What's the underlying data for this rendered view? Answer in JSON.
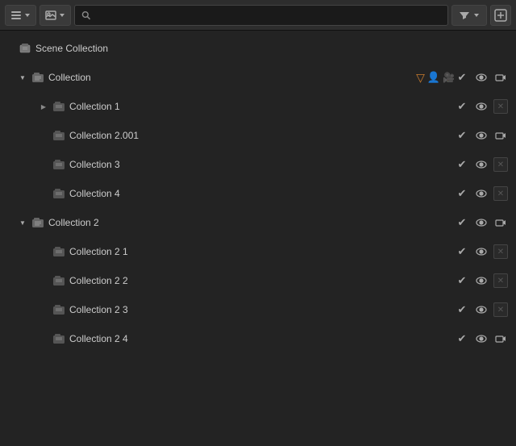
{
  "header": {
    "view_mode_label": "≡",
    "display_mode_label": "🖼",
    "search_placeholder": "",
    "filter_label": "▽",
    "add_label": "+"
  },
  "tree": {
    "items": [
      {
        "id": "scene-collection",
        "label": "Scene Collection",
        "indent": 0,
        "type": "scene",
        "expanded": true,
        "has_arrow": false,
        "show_controls": false,
        "show_cam": false,
        "show_x": false
      },
      {
        "id": "collection",
        "label": "Collection",
        "indent": 1,
        "type": "collection",
        "expanded": true,
        "has_arrow": true,
        "arrow_down": true,
        "show_controls": true,
        "show_cam": true,
        "show_x": false,
        "inline_objects": [
          "cone",
          "lamp",
          "camera"
        ]
      },
      {
        "id": "collection-1",
        "label": "Collection 1",
        "indent": 2,
        "type": "collection",
        "expanded": false,
        "has_arrow": true,
        "arrow_down": false,
        "show_controls": true,
        "show_cam": false,
        "show_x": true
      },
      {
        "id": "collection-2-001",
        "label": "Collection 2.001",
        "indent": 2,
        "type": "collection",
        "expanded": false,
        "has_arrow": false,
        "show_controls": true,
        "show_cam": true,
        "show_x": false
      },
      {
        "id": "collection-3",
        "label": "Collection 3",
        "indent": 2,
        "type": "collection",
        "expanded": false,
        "has_arrow": false,
        "show_controls": true,
        "show_cam": false,
        "show_x": true
      },
      {
        "id": "collection-4",
        "label": "Collection 4",
        "indent": 2,
        "type": "collection",
        "expanded": false,
        "has_arrow": false,
        "show_controls": true,
        "show_cam": false,
        "show_x": true
      },
      {
        "id": "collection-2",
        "label": "Collection 2",
        "indent": 1,
        "type": "collection",
        "expanded": true,
        "has_arrow": true,
        "arrow_down": true,
        "show_controls": true,
        "show_cam": true,
        "show_x": false
      },
      {
        "id": "collection-2-1",
        "label": "Collection 2 1",
        "indent": 2,
        "type": "collection",
        "expanded": false,
        "has_arrow": false,
        "show_controls": true,
        "show_cam": false,
        "show_x": true
      },
      {
        "id": "collection-2-2",
        "label": "Collection 2 2",
        "indent": 2,
        "type": "collection",
        "expanded": false,
        "has_arrow": false,
        "show_controls": true,
        "show_cam": false,
        "show_x": true
      },
      {
        "id": "collection-2-3",
        "label": "Collection 2 3",
        "indent": 2,
        "type": "collection",
        "expanded": false,
        "has_arrow": false,
        "show_controls": true,
        "show_cam": false,
        "show_x": true
      },
      {
        "id": "collection-2-4",
        "label": "Collection 2 4",
        "indent": 2,
        "type": "collection",
        "expanded": false,
        "has_arrow": false,
        "show_controls": true,
        "show_cam": true,
        "show_x": false
      }
    ]
  }
}
